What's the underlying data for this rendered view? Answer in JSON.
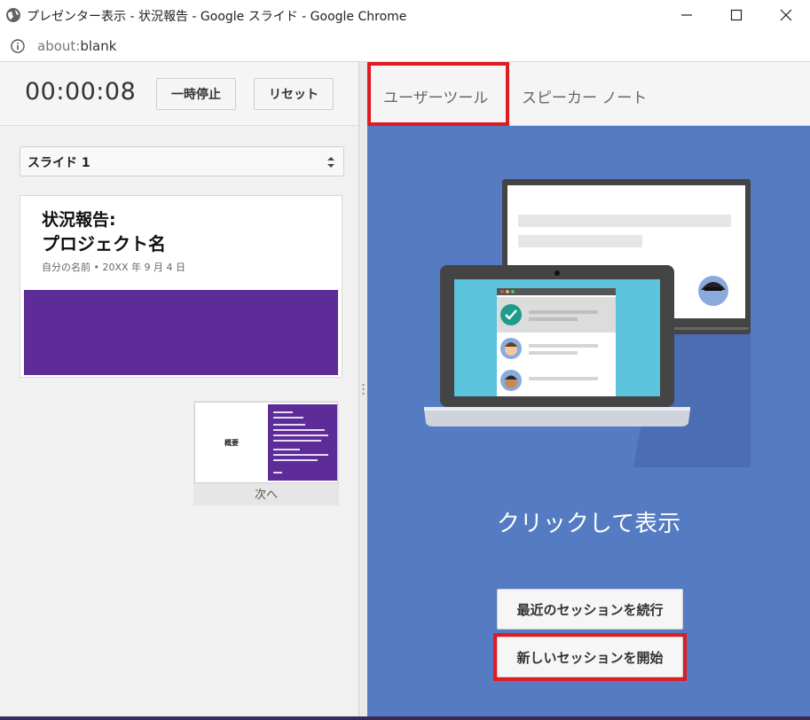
{
  "window": {
    "title": "プレゼンター表示 - 状況報告 - Google スライド - Google Chrome"
  },
  "address": {
    "scheme": "about:",
    "path": "blank"
  },
  "presenter": {
    "timer": "00:00:08",
    "pause_label": "一時停止",
    "reset_label": "リセット",
    "slide_select": "スライド 1",
    "current_slide": {
      "title_line1": "状況報告:",
      "title_line2": "プロジェクト名",
      "subtitle": "自分の名前 • 20XX 年 9 月 4 日",
      "band_color": "#5d2c99"
    },
    "next_slide": {
      "thumb_title": "概要",
      "label": "次へ"
    }
  },
  "tabs": {
    "user_tools": "ユーザーツール",
    "speaker_notes": "スピーカー ノート"
  },
  "user_tools": {
    "cta": "クリックして表示",
    "continue_label": "最近のセッションを続行",
    "new_label": "新しいセッションを開始"
  },
  "colors": {
    "accent_blue": "#557bc2",
    "highlight_red": "#e11b22"
  }
}
